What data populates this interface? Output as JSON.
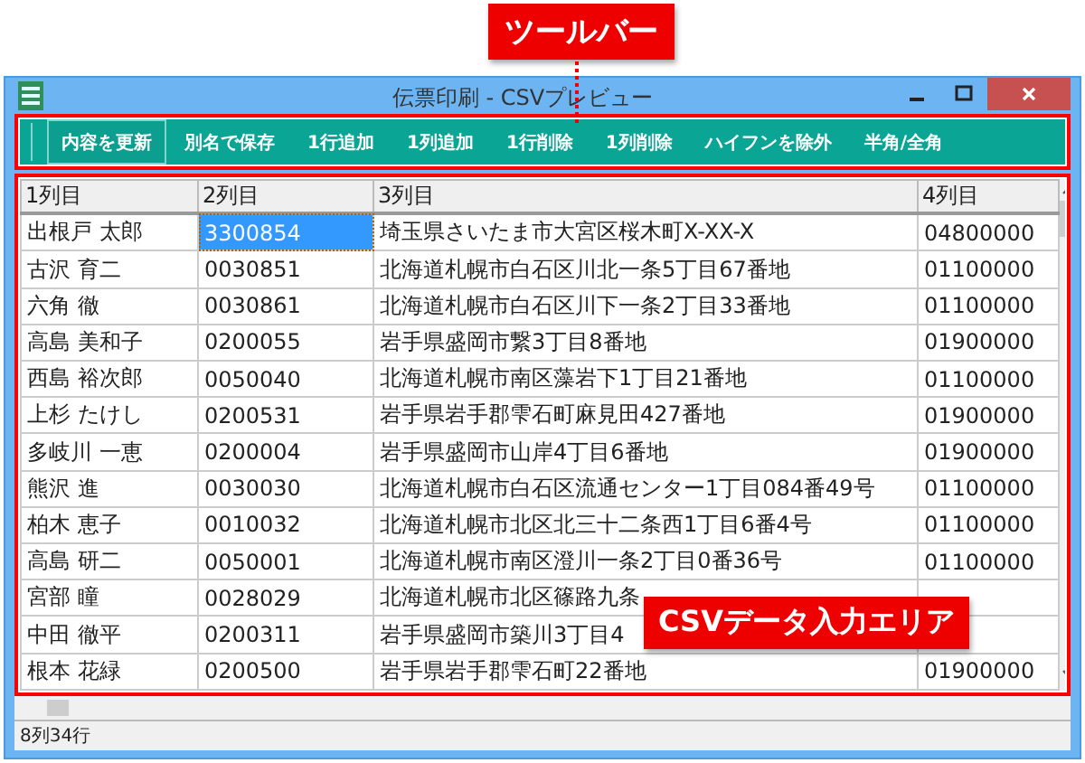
{
  "callouts": [
    {
      "kind": "toolbar",
      "text": "ツールバー"
    },
    {
      "kind": "grid",
      "text": "CSVデータ入力エリア"
    }
  ],
  "window": {
    "title": "伝票印刷 - CSVプレビュー"
  },
  "toolbar": [
    {
      "label": "内容を更新",
      "selected": true
    },
    {
      "label": "別名で保存",
      "selected": false
    },
    {
      "label": "1行追加",
      "selected": false
    },
    {
      "label": "1列追加",
      "selected": false
    },
    {
      "label": "1行削除",
      "selected": false
    },
    {
      "label": "1列削除",
      "selected": false
    },
    {
      "label": "ハイフンを除外",
      "selected": false
    },
    {
      "label": "半角/全角",
      "selected": false
    }
  ],
  "table": {
    "columns": [
      "1列目",
      "2列目",
      "3列目",
      "4列目"
    ],
    "rows": [
      {
        "cells": [
          {
            "text": "出根戸 太郎",
            "selected": false
          },
          {
            "text": "3300854",
            "selected": true
          },
          {
            "text": "埼玉県さいたま市大宮区桜木町X-XX-X",
            "selected": false
          },
          {
            "text": "04800000",
            "selected": false
          }
        ]
      },
      {
        "cells": [
          {
            "text": "古沢 育二",
            "selected": false
          },
          {
            "text": "0030851",
            "selected": false
          },
          {
            "text": "北海道札幌市白石区川北一条5丁目67番地",
            "selected": false
          },
          {
            "text": "01100000",
            "selected": false
          }
        ]
      },
      {
        "cells": [
          {
            "text": "六角 徹",
            "selected": false
          },
          {
            "text": "0030861",
            "selected": false
          },
          {
            "text": "北海道札幌市白石区川下一条2丁目33番地",
            "selected": false
          },
          {
            "text": "01100000",
            "selected": false
          }
        ]
      },
      {
        "cells": [
          {
            "text": "高島 美和子",
            "selected": false
          },
          {
            "text": "0200055",
            "selected": false
          },
          {
            "text": "岩手県盛岡市繋3丁目8番地",
            "selected": false
          },
          {
            "text": "01900000",
            "selected": false
          }
        ]
      },
      {
        "cells": [
          {
            "text": "西島 裕次郎",
            "selected": false
          },
          {
            "text": "0050040",
            "selected": false
          },
          {
            "text": "北海道札幌市南区藻岩下1丁目21番地",
            "selected": false
          },
          {
            "text": "01100000",
            "selected": false
          }
        ]
      },
      {
        "cells": [
          {
            "text": "上杉 たけし",
            "selected": false
          },
          {
            "text": "0200531",
            "selected": false
          },
          {
            "text": "岩手県岩手郡雫石町麻見田427番地",
            "selected": false
          },
          {
            "text": "01900000",
            "selected": false
          }
        ]
      },
      {
        "cells": [
          {
            "text": "多岐川 一恵",
            "selected": false
          },
          {
            "text": "0200004",
            "selected": false
          },
          {
            "text": "岩手県盛岡市山岸4丁目6番地",
            "selected": false
          },
          {
            "text": "01900000",
            "selected": false
          }
        ]
      },
      {
        "cells": [
          {
            "text": "熊沢 進",
            "selected": false
          },
          {
            "text": "0030030",
            "selected": false
          },
          {
            "text": "北海道札幌市白石区流通センター1丁目084番49号",
            "selected": false
          },
          {
            "text": "01100000",
            "selected": false
          }
        ]
      },
      {
        "cells": [
          {
            "text": "柏木 恵子",
            "selected": false
          },
          {
            "text": "0010032",
            "selected": false
          },
          {
            "text": "北海道札幌市北区北三十二条西1丁目6番4号",
            "selected": false
          },
          {
            "text": "01100000",
            "selected": false
          }
        ]
      },
      {
        "cells": [
          {
            "text": "高島 研二",
            "selected": false
          },
          {
            "text": "0050001",
            "selected": false
          },
          {
            "text": "北海道札幌市南区澄川一条2丁目0番36号",
            "selected": false
          },
          {
            "text": "01100000",
            "selected": false
          }
        ]
      },
      {
        "cells": [
          {
            "text": "宮部 瞳",
            "selected": false
          },
          {
            "text": "0028029",
            "selected": false
          },
          {
            "text": "北海道札幌市北区篠路九条",
            "selected": false
          }
        ]
      },
      {
        "cells": [
          {
            "text": "中田 徹平",
            "selected": false
          },
          {
            "text": "0200311",
            "selected": false
          },
          {
            "text": "岩手県盛岡市築川3丁目4",
            "selected": false
          }
        ]
      },
      {
        "cells": [
          {
            "text": "根本 花緑",
            "selected": false
          },
          {
            "text": "0200500",
            "selected": false
          },
          {
            "text": "岩手県岩手郡雫石町22番地",
            "selected": false
          },
          {
            "text": "01900000",
            "selected": false
          }
        ]
      }
    ]
  },
  "status_bar": "8列34行"
}
